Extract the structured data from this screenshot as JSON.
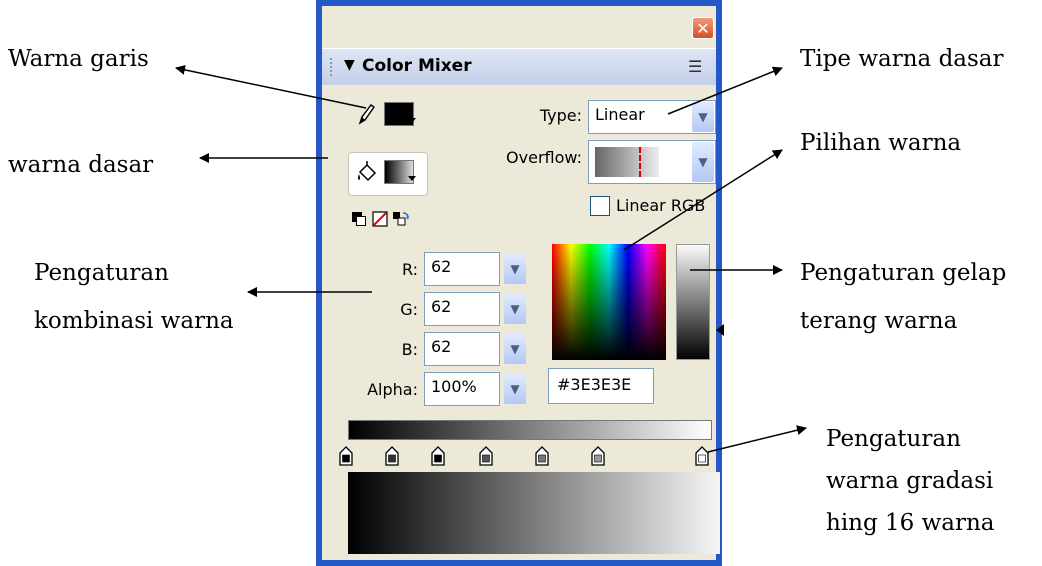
{
  "annotations": {
    "warna_garis": "Warna garis",
    "warna_dasar": "warna dasar",
    "pengaturan_kombinasi_1": "Pengaturan",
    "pengaturan_kombinasi_2": "kombinasi warna",
    "tipe_warna_dasar": "Tipe warna dasar",
    "pilihan_warna": "Pilihan warna",
    "pengaturan_gelap_1": "Pengaturan gelap",
    "pengaturan_gelap_2": "terang warna",
    "pengaturan_gradasi_1": "Pengaturan",
    "pengaturan_gradasi_2": "warna gradasi",
    "pengaturan_gradasi_3": "hing 16 warna"
  },
  "panel": {
    "title": "Color Mixer",
    "close_glyph": "✕",
    "type_label": "Type:",
    "type_value": "Linear",
    "overflow_label": "Overflow:",
    "linear_rgb_label": "Linear RGB",
    "linear_rgb_checked": false,
    "r_label": "R:",
    "r_value": "62",
    "g_label": "G:",
    "g_value": "62",
    "b_label": "B:",
    "b_value": "62",
    "alpha_label": "Alpha:",
    "alpha_value": "100%",
    "hex_value": "#3E3E3E",
    "gradient_stop_count": 7
  },
  "icons": {
    "stroke": "pencil-icon",
    "fill": "paint-bucket-icon",
    "menu": "options-menu-icon",
    "close": "close-icon",
    "dropdown": "chevron-down-icon"
  },
  "colors": {
    "window_frame": "#2458c8",
    "panel_bg": "#ece9d8",
    "current_color": "#3E3E3E"
  }
}
